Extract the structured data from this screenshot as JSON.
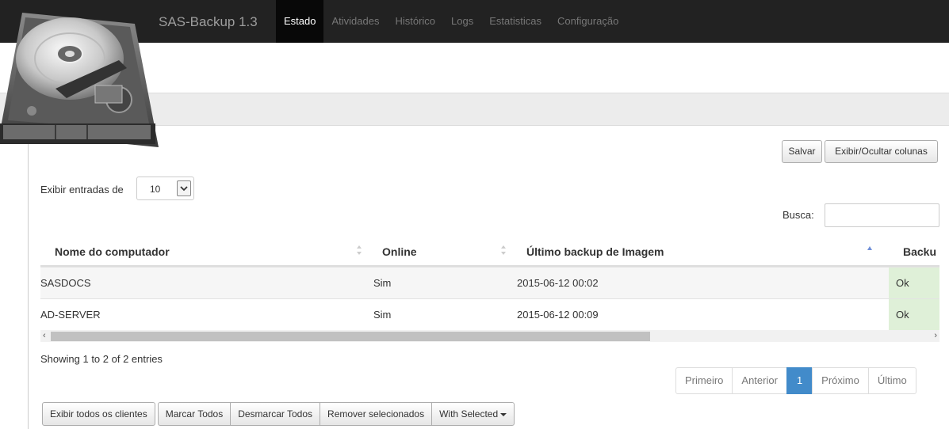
{
  "app": {
    "brand": "SAS-Backup 1.3"
  },
  "nav": [
    {
      "label": "Estado",
      "active": true
    },
    {
      "label": "Atividades"
    },
    {
      "label": "Histórico"
    },
    {
      "label": "Logs"
    },
    {
      "label": "Estatisticas"
    },
    {
      "label": "Configuração"
    }
  ],
  "toolbar": {
    "save_label": "Salvar",
    "columns_label": "Exibir/Ocultar colunas"
  },
  "length": {
    "label": "Exibir entradas de",
    "value": "10"
  },
  "search": {
    "label": "Busca:",
    "value": ""
  },
  "table": {
    "headers": [
      "Nome do computador",
      "Online",
      "Último backup de Imagem",
      "Backu"
    ],
    "rows": [
      {
        "name": "SASDOCS",
        "online": "Sim",
        "last_backup": "2015-06-12 00:02",
        "status": "Ok"
      },
      {
        "name": "AD-SERVER",
        "online": "Sim",
        "last_backup": "2015-06-12 00:09",
        "status": "Ok"
      }
    ]
  },
  "info": "Showing 1 to 2 of 2 entries",
  "pagination": {
    "first": "Primeiro",
    "prev": "Anterior",
    "current": "1",
    "next": "Próximo",
    "last": "Último"
  },
  "actions": {
    "show_all": "Exibir todos os clientes",
    "mark_all": "Marcar Todos",
    "unmark_all": "Desmarcar Todos",
    "remove_selected": "Remover selecionados",
    "with_selected": "With Selected"
  },
  "colors": {
    "navbar": "#222222",
    "active_nav": "#080808",
    "ok_cell": "#dff0d8",
    "page_active": "#428bca"
  }
}
